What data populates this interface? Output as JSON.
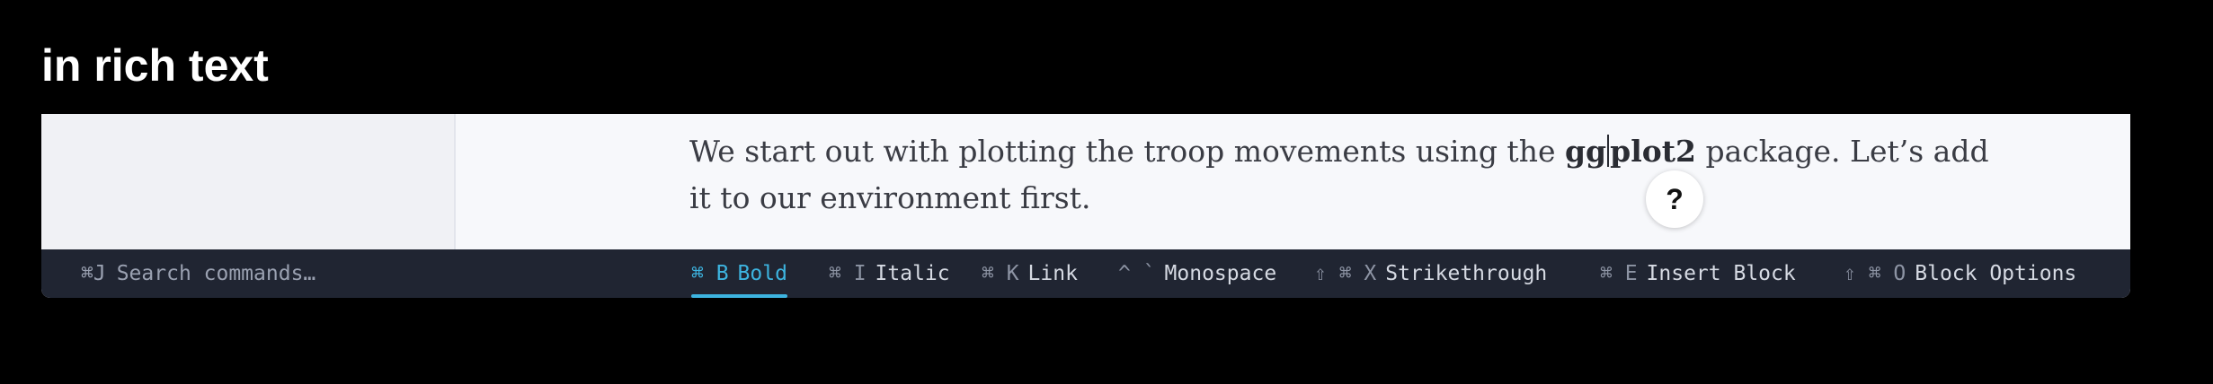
{
  "slide": {
    "title": "in rich text"
  },
  "document": {
    "line1_before": "We start out with plotting the troop movements using the ",
    "line1_bold_a": "gg",
    "line1_bold_b": "plot2",
    "line1_after": " package. Let’s add",
    "line2": "it to our environment first."
  },
  "help_button": {
    "label": "?"
  },
  "command_bar": {
    "search": {
      "shortcut": "⌘J",
      "label": "Search commands…"
    },
    "commands": [
      {
        "shortcut": "⌘ B",
        "label": "Bold",
        "active": true
      },
      {
        "shortcut": "⌘ I",
        "label": "Italic",
        "active": false
      },
      {
        "shortcut": "⌘ K",
        "label": "Link",
        "active": false
      },
      {
        "shortcut": "^ `",
        "label": "Monospace",
        "active": false
      },
      {
        "shortcut": "⇧ ⌘ X",
        "label": "Strikethrough",
        "active": false
      },
      {
        "shortcut": "⌘ E",
        "label": "Insert Block",
        "active": false
      },
      {
        "shortcut": "⇧ ⌘ O",
        "label": "Block Options",
        "active": false
      }
    ]
  },
  "colors": {
    "accent": "#3db4e0",
    "command_bar_bg": "#202532",
    "editor_bg": "#f7f8fb"
  }
}
